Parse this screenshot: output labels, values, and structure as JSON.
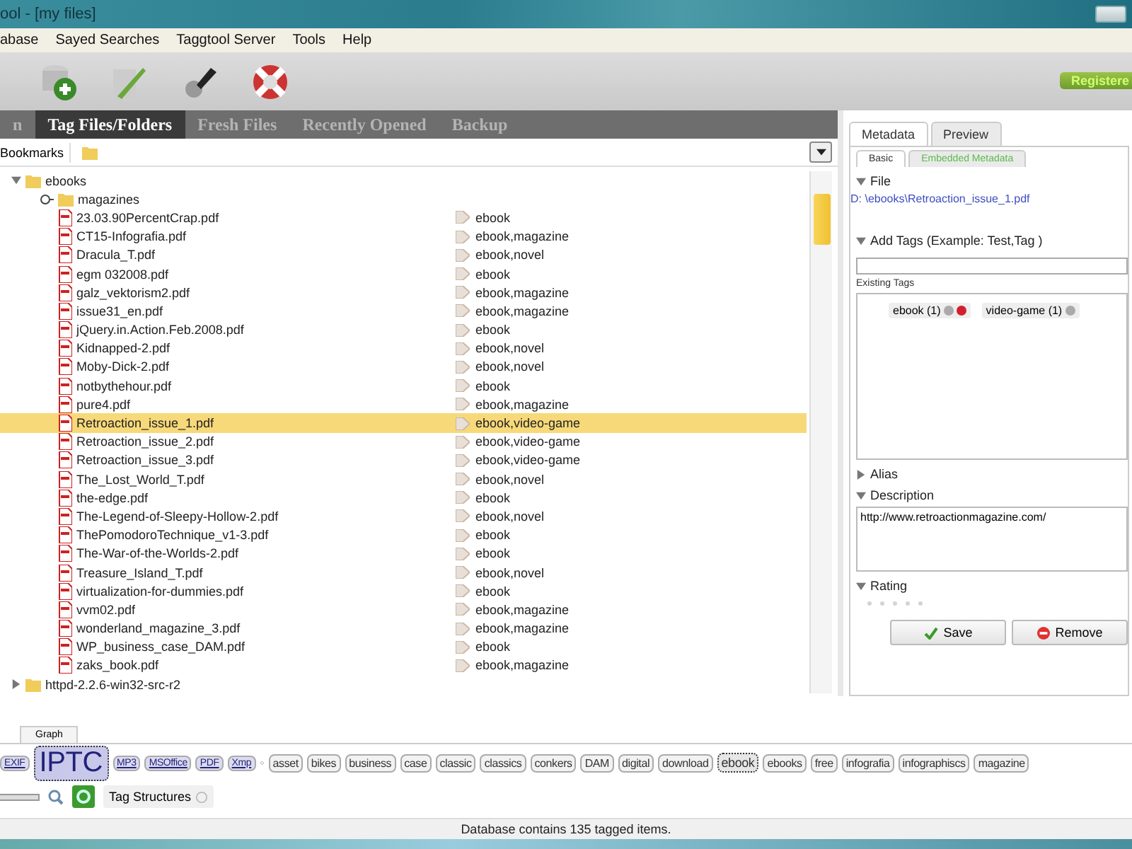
{
  "window": {
    "title": "ool - [my files]",
    "badge": "Registere"
  },
  "menu": [
    "abase",
    "Sayed Searches",
    "Taggtool Server",
    "Tools",
    "Help"
  ],
  "toolbar": [
    {
      "kind": "db-add"
    },
    {
      "kind": "db-edit"
    },
    {
      "kind": "tool"
    },
    {
      "kind": "lifebuoy"
    }
  ],
  "tabs": [
    {
      "label": "n",
      "selected": false
    },
    {
      "label": "Tag Files/Folders",
      "selected": true
    },
    {
      "label": "Fresh Files",
      "selected": false
    },
    {
      "label": "Recently Opened",
      "selected": false
    },
    {
      "label": "Backup",
      "selected": false
    }
  ],
  "bookmarks": {
    "label": "Bookmarks"
  },
  "tree": [
    {
      "name": "ebooks",
      "kind": "folder",
      "expanded": true,
      "children": [
        {
          "name": "magazines",
          "kind": "folder",
          "expanded": false
        },
        {
          "name": "23.03.90PercentCrap.pdf",
          "kind": "pdf",
          "tags": "ebook",
          "selected": false
        },
        {
          "name": "CT15-Infografia.pdf",
          "kind": "pdf",
          "tags": "ebook,magazine",
          "selected": false
        },
        {
          "name": "Dracula_T.pdf",
          "kind": "pdf",
          "tags": "ebook,novel",
          "selected": false
        },
        {
          "name": "egm 032008.pdf",
          "kind": "pdf",
          "tags": "ebook",
          "selected": false
        },
        {
          "name": "galz_vektorism2.pdf",
          "kind": "pdf",
          "tags": "ebook,magazine",
          "selected": false
        },
        {
          "name": "issue31_en.pdf",
          "kind": "pdf",
          "tags": "ebook,magazine",
          "selected": false
        },
        {
          "name": "jQuery.in.Action.Feb.2008.pdf",
          "kind": "pdf",
          "tags": "ebook",
          "selected": false
        },
        {
          "name": "Kidnapped-2.pdf",
          "kind": "pdf",
          "tags": "ebook,novel",
          "selected": false
        },
        {
          "name": "Moby-Dick-2.pdf",
          "kind": "pdf",
          "tags": "ebook,novel",
          "selected": false
        },
        {
          "name": "notbythehour.pdf",
          "kind": "pdf",
          "tags": "ebook",
          "selected": false
        },
        {
          "name": "pure4.pdf",
          "kind": "pdf",
          "tags": "ebook,magazine",
          "selected": false
        },
        {
          "name": "Retroaction_issue_1.pdf",
          "kind": "pdf",
          "tags": "ebook,video-game",
          "selected": true
        },
        {
          "name": "Retroaction_issue_2.pdf",
          "kind": "pdf",
          "tags": "ebook,video-game",
          "selected": false
        },
        {
          "name": "Retroaction_issue_3.pdf",
          "kind": "pdf",
          "tags": "ebook,video-game",
          "selected": false
        },
        {
          "name": "The_Lost_World_T.pdf",
          "kind": "pdf",
          "tags": "ebook,novel",
          "selected": false
        },
        {
          "name": "the-edge.pdf",
          "kind": "pdf",
          "tags": "ebook",
          "selected": false
        },
        {
          "name": "The-Legend-of-Sleepy-Hollow-2.pdf",
          "kind": "pdf",
          "tags": "ebook,novel",
          "selected": false
        },
        {
          "name": "ThePomodoroTechnique_v1-3.pdf",
          "kind": "pdf",
          "tags": "ebook",
          "selected": false
        },
        {
          "name": "The-War-of-the-Worlds-2.pdf",
          "kind": "pdf",
          "tags": "ebook",
          "selected": false
        },
        {
          "name": "Treasure_Island_T.pdf",
          "kind": "pdf",
          "tags": "ebook,novel",
          "selected": false
        },
        {
          "name": "virtualization-for-dummies.pdf",
          "kind": "pdf",
          "tags": "ebook",
          "selected": false
        },
        {
          "name": "vvm02.pdf",
          "kind": "pdf",
          "tags": "ebook,magazine",
          "selected": false
        },
        {
          "name": "wonderland_magazine_3.pdf",
          "kind": "pdf",
          "tags": "ebook,magazine",
          "selected": false
        },
        {
          "name": "WP_business_case_DAM.pdf",
          "kind": "pdf",
          "tags": "ebook",
          "selected": false
        },
        {
          "name": "zaks_book.pdf",
          "kind": "pdf",
          "tags": "ebook,magazine",
          "selected": false
        }
      ]
    },
    {
      "name": "httpd-2.2.6-win32-src-r2",
      "kind": "folder",
      "expanded": false
    }
  ],
  "panel": {
    "tabs": [
      {
        "label": "Metadata",
        "selected": true
      },
      {
        "label": "Preview",
        "selected": false
      }
    ],
    "subtabs": [
      {
        "label": "Basic",
        "selected": true
      },
      {
        "label": "Embedded Metadata",
        "selected": false
      }
    ],
    "file": {
      "title": "File",
      "expanded": true,
      "path": "D: \\ebooks\\Retroaction_issue_1.pdf"
    },
    "add_tags": {
      "title": "Add Tags (Example: Test,Tag )",
      "expanded": true
    },
    "existing_tags": {
      "label": "Existing Tags",
      "tags": [
        {
          "label": "ebook (1)"
        },
        {
          "label": "video-game (1)"
        }
      ]
    },
    "alias": {
      "title": "Alias",
      "expanded": false
    },
    "description": {
      "title": "Description",
      "expanded": true,
      "value": "http://www.retroactionmagazine.com/"
    },
    "rating": {
      "title": "Rating",
      "expanded": true,
      "stars": 0
    },
    "buttons": [
      "Save",
      "Remove"
    ]
  },
  "bottom_tabs": [
    {
      "label": "Graph"
    }
  ],
  "cloud": [
    {
      "label": "EXIF",
      "kind": "structure",
      "selected": false
    },
    {
      "label": "IPTC",
      "kind": "structure",
      "selected": true
    },
    {
      "label": "MP3",
      "kind": "structure",
      "selected": false
    },
    {
      "label": "MSOffice",
      "kind": "structure",
      "selected": false
    },
    {
      "label": "PDF",
      "kind": "structure",
      "selected": false
    },
    {
      "label": "Xmp",
      "kind": "structure",
      "selected": false
    },
    {
      "label": "◦",
      "kind": "separator"
    },
    {
      "label": "asset",
      "kind": "tag",
      "selected": false
    },
    {
      "label": "bikes",
      "kind": "tag",
      "selected": false
    },
    {
      "label": "business",
      "kind": "tag",
      "selected": false
    },
    {
      "label": "case",
      "kind": "tag",
      "selected": false
    },
    {
      "label": "classic",
      "kind": "tag",
      "selected": false
    },
    {
      "label": "classics",
      "kind": "tag",
      "selected": false
    },
    {
      "label": "conkers",
      "kind": "tag",
      "selected": false
    },
    {
      "label": "DAM",
      "kind": "tag",
      "selected": false
    },
    {
      "label": "digital",
      "kind": "tag",
      "selected": false
    },
    {
      "label": "download",
      "kind": "tag",
      "selected": false
    },
    {
      "label": "ebook",
      "kind": "tag",
      "selected": true
    },
    {
      "label": "ebooks",
      "kind": "tag",
      "selected": false
    },
    {
      "label": "free",
      "kind": "tag",
      "selected": false
    },
    {
      "label": "infografia",
      "kind": "tag",
      "selected": false
    },
    {
      "label": "infographiscs",
      "kind": "tag",
      "selected": false
    },
    {
      "label": "magazine",
      "kind": "tag",
      "selected": false
    }
  ],
  "zoom": {
    "level": 1
  },
  "tag_structures": {
    "label": "Tag Structures"
  },
  "status_bar": "Database contains 135 tagged items."
}
